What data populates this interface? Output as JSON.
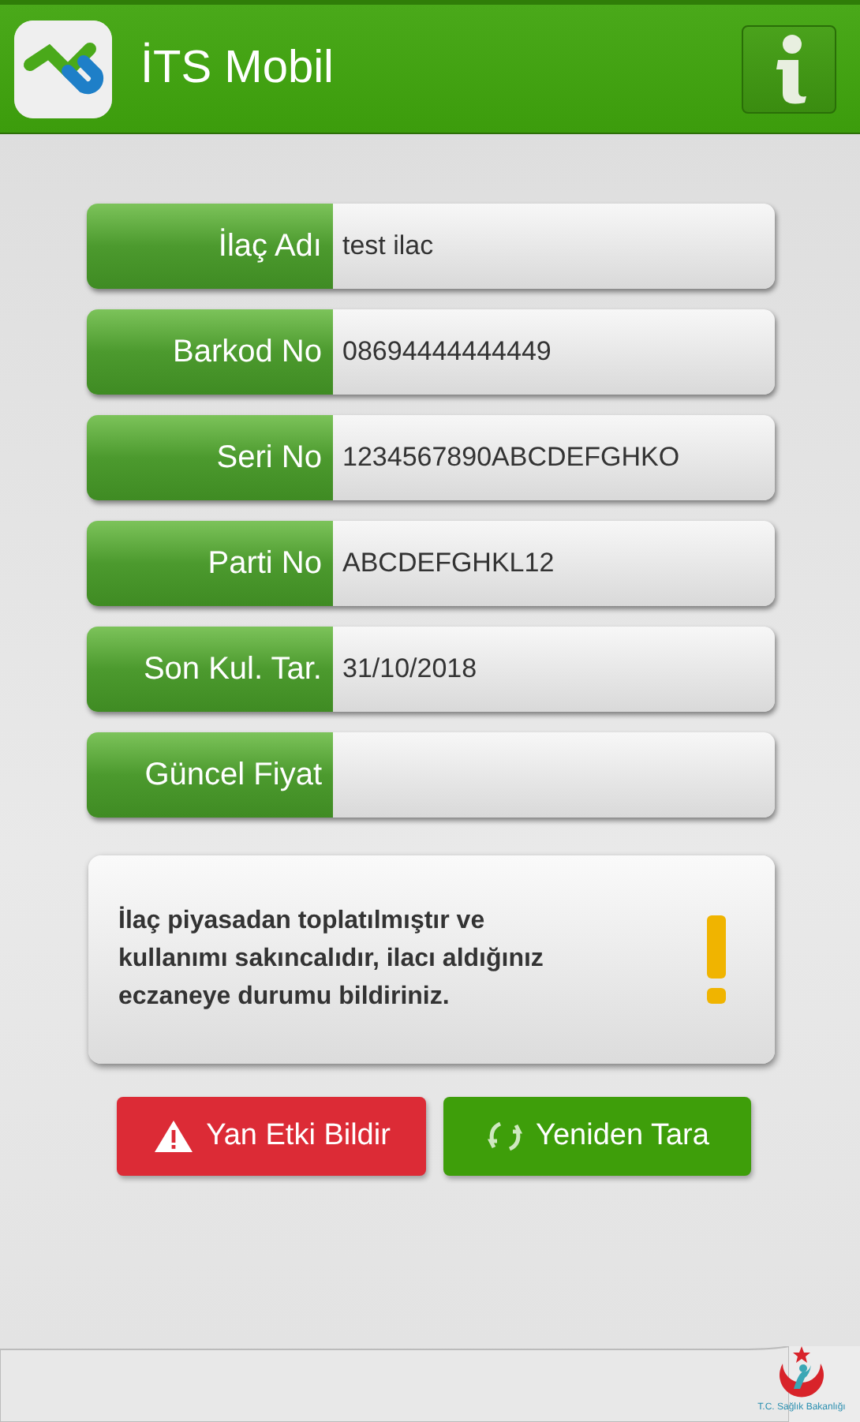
{
  "header": {
    "title": "İTS Mobil"
  },
  "fields": [
    {
      "label": "İlaç Adı",
      "value": "test ilac"
    },
    {
      "label": "Barkod No",
      "value": "08694444444449"
    },
    {
      "label": "Seri No",
      "value": "1234567890ABCDEFGHKO"
    },
    {
      "label": "Parti No",
      "value": "ABCDEFGHKL12"
    },
    {
      "label": "Son Kul. Tar.",
      "value": "31/10/2018"
    },
    {
      "label": "Güncel Fiyat"
    }
  ],
  "warning": {
    "text": "İlaç piyasadan toplatılmıştır ve kullanımı sakıncalıdır, ilacı aldığınız eczaneye durumu bildiriniz."
  },
  "buttons": [
    {
      "label": "Yan Etki Bildir",
      "kind": "report"
    },
    {
      "label": "Yeniden Tara",
      "kind": "rescan"
    }
  ],
  "footer": {
    "ministry": "T.C. Sağlık Bakanlığı"
  }
}
